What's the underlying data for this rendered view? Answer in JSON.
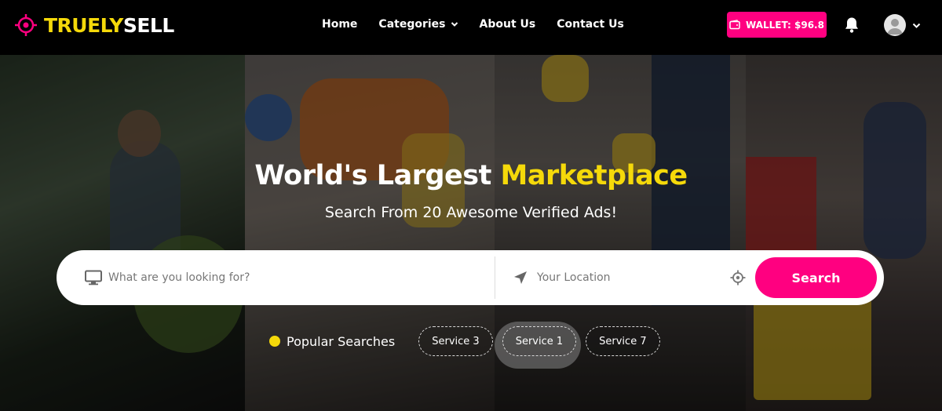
{
  "brand": {
    "name_part1": "TRUELY",
    "name_part2": "SELL",
    "logo_icon": "crosshair-logo-icon",
    "accent_color": "#f5d90a",
    "primary_color": "#ff0080"
  },
  "nav": {
    "items": [
      {
        "label": "Home"
      },
      {
        "label": "Categories",
        "has_dropdown": true
      },
      {
        "label": "About Us"
      },
      {
        "label": "Contact Us"
      }
    ]
  },
  "header_actions": {
    "wallet_label": "WALLET: $96.8",
    "wallet_icon": "wallet-icon",
    "bell_icon": "bell-icon",
    "avatar_icon": "user-avatar-icon"
  },
  "hero": {
    "title_main": "World's Largest ",
    "title_accent": "Marketplace",
    "subtitle": "Search From 20 Awesome Verified Ads!"
  },
  "search": {
    "keyword_placeholder": "What are you looking for?",
    "location_placeholder": "Your Location",
    "button_label": "Search"
  },
  "popular": {
    "label": "Popular Searches",
    "tags": [
      "Service 3",
      "Service 1",
      "Service 7"
    ]
  }
}
